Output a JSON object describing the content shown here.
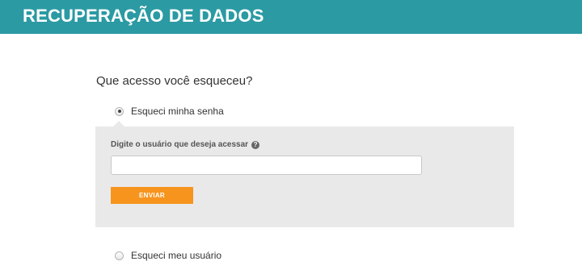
{
  "header": {
    "title": "RECUPERAÇÃO DE DADOS",
    "background_color": "#2b9aa3"
  },
  "form": {
    "question": "Que acesso você esqueceu?",
    "options": [
      {
        "label": "Esqueci minha senha",
        "selected": true
      },
      {
        "label": "Esqueci meu usuário",
        "selected": false
      }
    ],
    "panel": {
      "field_label": "Digite o usuário que deseja acessar",
      "help_icon": "question-circle-icon",
      "input_value": "",
      "input_placeholder": "",
      "submit_label": "ENVIAR",
      "submit_color": "#f7941d",
      "panel_color": "#e9e9e9"
    }
  }
}
